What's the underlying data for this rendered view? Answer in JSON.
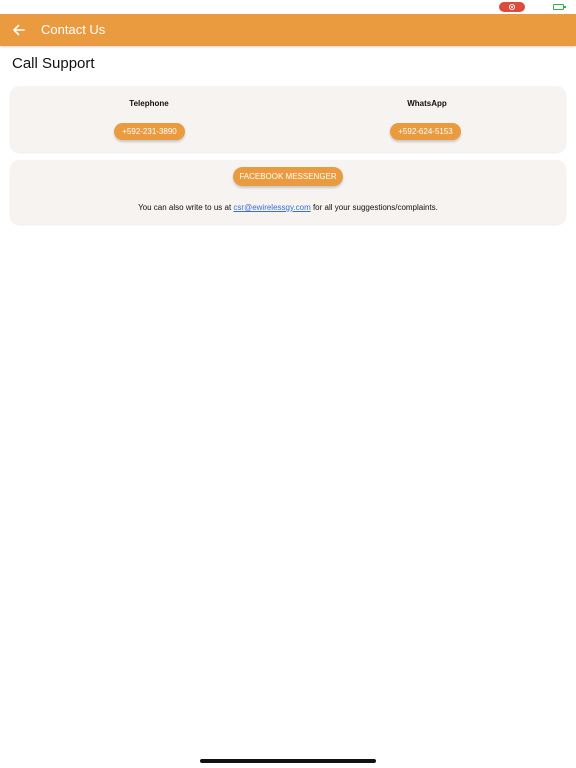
{
  "colors": {
    "accent": "#eb9b3f",
    "card_bg": "#f6f3f1",
    "link": "#3b6fd6",
    "status_pill": "#dd4b3f",
    "battery": "#2db34a"
  },
  "status_bar": {
    "icons": [
      "recording-indicator-icon",
      "battery-icon"
    ]
  },
  "app_bar": {
    "back_icon": "arrow-left-icon",
    "title": "Contact Us"
  },
  "page": {
    "title": "Call Support"
  },
  "phones": {
    "telephone": {
      "label": "Telephone",
      "number": "+592-231-3890"
    },
    "whatsapp": {
      "label": "WhatsApp",
      "number": "+592-624-5153"
    }
  },
  "contact": {
    "messenger_label": "FACEBOOK MESSENGER",
    "write_prefix": "You can also write to us at ",
    "email": "csr@ewirelessgy.com",
    "write_suffix": " for all your suggestions/complaints."
  }
}
